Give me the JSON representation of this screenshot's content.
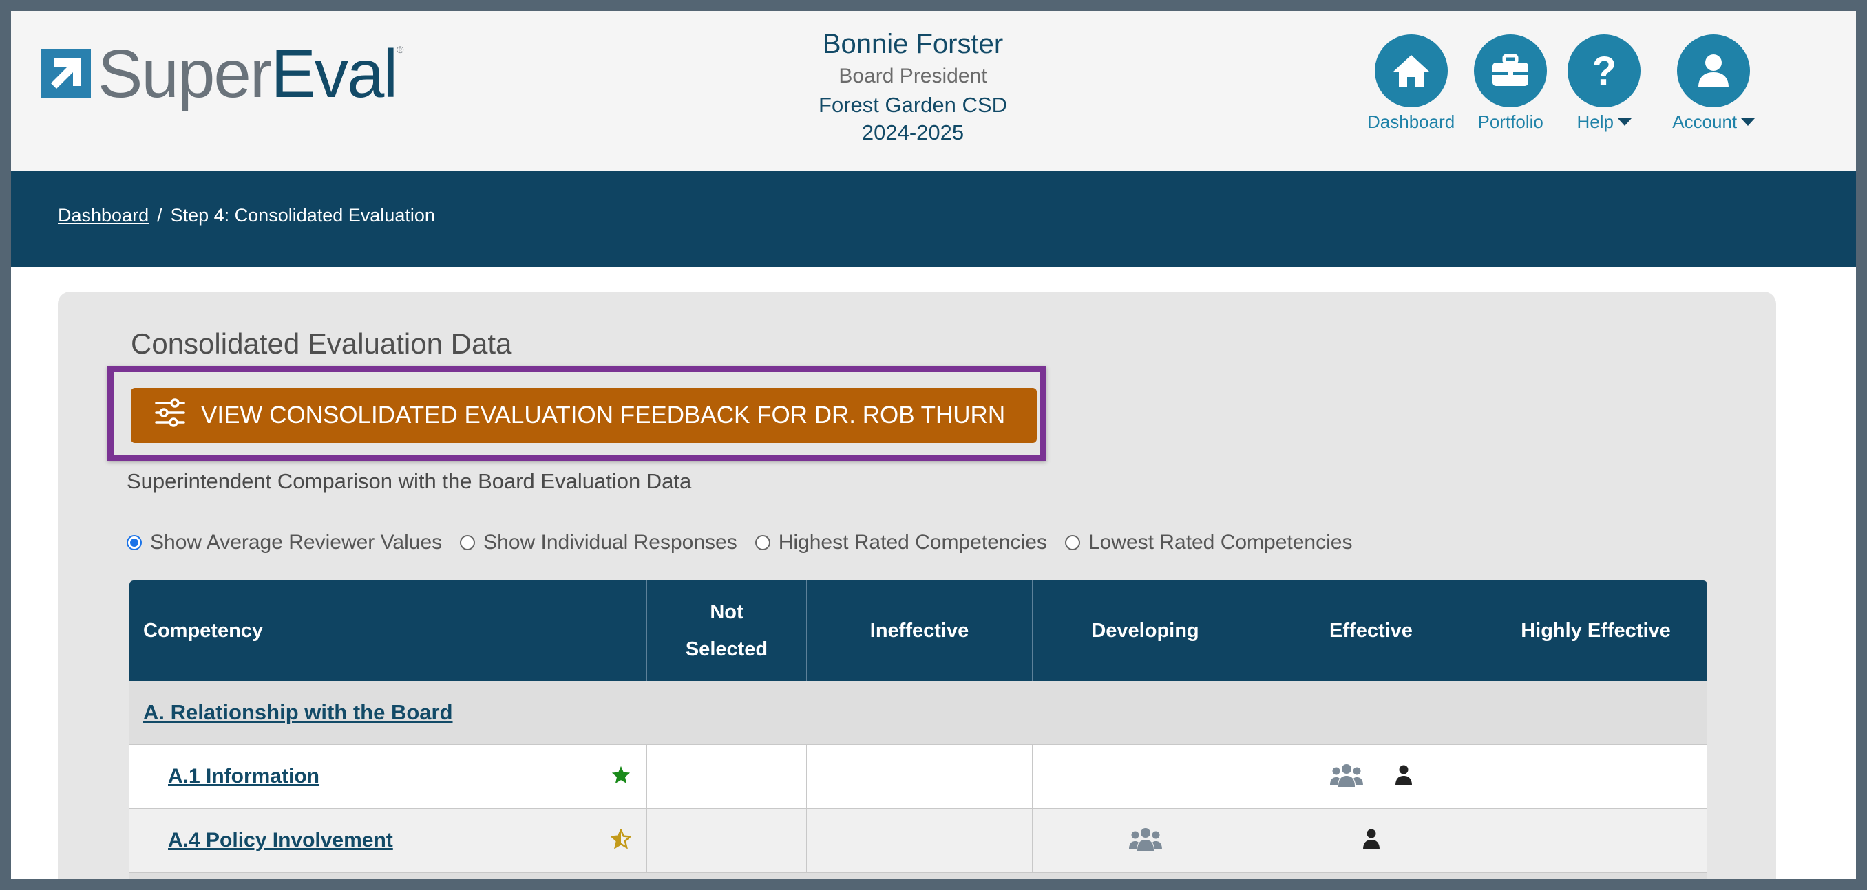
{
  "header": {
    "logo": {
      "text_light": "Super",
      "text_dark": "Eval",
      "reg": "®"
    },
    "user": {
      "name": "Bonnie Forster",
      "role": "Board President",
      "org": "Forest Garden CSD",
      "year": "2024-2025"
    },
    "nav": [
      {
        "label": "Dashboard",
        "icon": "home-icon"
      },
      {
        "label": "Portfolio",
        "icon": "briefcase-icon"
      },
      {
        "label": "Help",
        "icon": "question-icon",
        "caret": true
      },
      {
        "label": "Account",
        "icon": "user-icon",
        "caret": true
      }
    ]
  },
  "breadcrumb": {
    "home": "Dashboard",
    "separator": "/",
    "current": "Step 4: Consolidated Evaluation"
  },
  "panel": {
    "title": "Consolidated Evaluation Data",
    "feedback_button": "VIEW CONSOLIDATED EVALUATION FEEDBACK FOR DR. ROB THURN",
    "subtitle": "Superintendent Comparison with the Board Evaluation Data",
    "radios": [
      {
        "label": "Show Average Reviewer Values",
        "checked": true
      },
      {
        "label": "Show Individual Responses",
        "checked": false
      },
      {
        "label": "Highest Rated Competencies",
        "checked": false
      },
      {
        "label": "Lowest Rated Competencies",
        "checked": false
      }
    ]
  },
  "table": {
    "headers": {
      "competency": "Competency",
      "not_selected_1": "Not",
      "not_selected_2": "Selected",
      "ineffective": "Ineffective",
      "developing": "Developing",
      "effective": "Effective",
      "highly_effective": "Highly Effective"
    },
    "group": "A. Relationship with the Board",
    "rows": [
      {
        "label": "A.1 Information",
        "star": "filled-green",
        "group_icon_col": "Effective",
        "self_icon_col": "Effective"
      },
      {
        "label": "A.4 Policy Involvement",
        "star": "half-gold",
        "group_icon_col": "Developing",
        "self_icon_col": "Effective"
      }
    ]
  },
  "colors": {
    "navy": "#0f4462",
    "accent_blue": "#1f82a8",
    "button_orange": "#b45f06",
    "highlight_purple": "#7a3393",
    "star_green": "#1a8a1a",
    "star_gold": "#c39a1a"
  }
}
